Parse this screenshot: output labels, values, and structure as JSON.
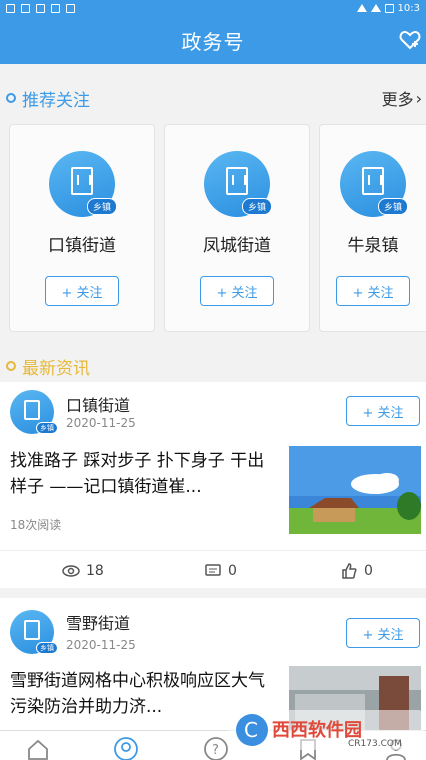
{
  "statusbar": {
    "time": "10:3"
  },
  "appbar": {
    "title": "政务号"
  },
  "recommend": {
    "label": "推荐关注",
    "more": "更多",
    "cards": [
      {
        "name": "口镇街道",
        "tag": "乡镇",
        "follow": "+ 关注"
      },
      {
        "name": "凤城街道",
        "tag": "乡镇",
        "follow": "+ 关注"
      },
      {
        "name": "牛泉镇",
        "tag": "乡镇",
        "follow": "+ 关注"
      }
    ]
  },
  "latest": {
    "label": "最新资讯"
  },
  "news": [
    {
      "source": "口镇街道",
      "date": "2020-11-25",
      "tag": "乡镇",
      "follow": "+ 关注",
      "headline": "找准路子 踩对步子 扑下身子 干出样子 ——记口镇街道崔...",
      "reads": "18次阅读",
      "views": "18",
      "comments": "0",
      "likes": "0"
    },
    {
      "source": "雪野街道",
      "date": "2020-11-25",
      "tag": "乡镇",
      "follow": "+ 关注",
      "headline": "雪野街道网格中心积极响应区大气污染防治并助力济..."
    }
  ],
  "watermark": {
    "text": "西西软件园",
    "sub": "CR173.COM"
  },
  "colors": {
    "primary": "#3d9ae6",
    "section": "#e6b93a"
  }
}
